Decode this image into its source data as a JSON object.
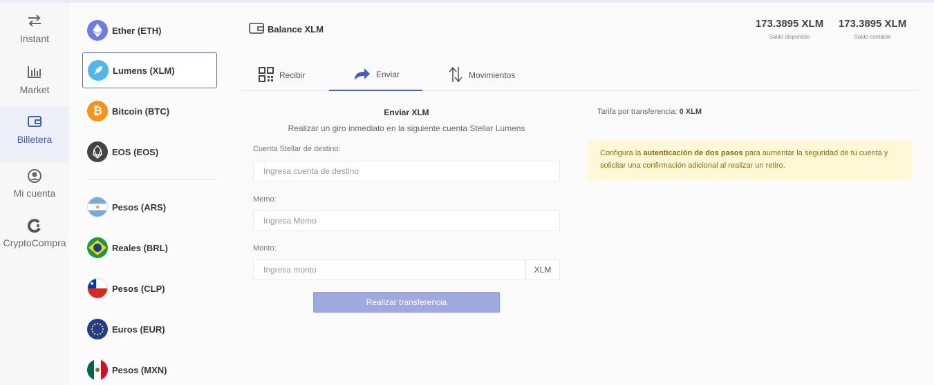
{
  "nav": {
    "items": [
      {
        "label": "Instant",
        "icon": "swap-arrows-icon"
      },
      {
        "label": "Market",
        "icon": "bar-chart-icon"
      },
      {
        "label": "Billetera",
        "icon": "wallet-icon"
      },
      {
        "label": "Mi cuenta",
        "icon": "user-circle-icon"
      },
      {
        "label": "CryptoCompra",
        "icon": "cryptocompra-icon"
      }
    ],
    "active": "Billetera"
  },
  "currencies": [
    {
      "label": "Ether (ETH)",
      "icon": "ethereum-icon",
      "color": "#6c7ce0"
    },
    {
      "label": "Lumens (XLM)",
      "icon": "rocket-icon",
      "color": "#4fb8ea",
      "selected": true
    },
    {
      "label": "Bitcoin (BTC)",
      "icon": "bitcoin-icon",
      "color": "#f7931a"
    },
    {
      "label": "EOS (EOS)",
      "icon": "eos-icon",
      "color": "#444444"
    },
    {
      "label": "Pesos (ARS)",
      "icon": "flag-argentina-icon"
    },
    {
      "label": "Reales (BRL)",
      "icon": "flag-brazil-icon"
    },
    {
      "label": "Pesos (CLP)",
      "icon": "flag-chile-icon"
    },
    {
      "label": "Euros (EUR)",
      "icon": "flag-eu-icon"
    },
    {
      "label": "Pesos (MXN)",
      "icon": "flag-mexico-icon"
    }
  ],
  "header": {
    "title": "Balance XLM",
    "available": {
      "value": "173.3895 XLM",
      "label": "Saldo disponible"
    },
    "accounting": {
      "value": "173.3895 XLM",
      "label": "Saldo contable"
    }
  },
  "tabs": [
    {
      "label": "Recibir",
      "icon": "qr-code-icon"
    },
    {
      "label": "Enviar",
      "icon": "send-arrow-icon",
      "active": true
    },
    {
      "label": "Movimientos",
      "icon": "up-down-arrows-icon"
    }
  ],
  "form": {
    "title": "Enviar XLM",
    "subtitle": "Realizar un giro inmediato en la siguiente cuenta Stellar Lumens",
    "dest_label": "Cuenta Stellar de destino:",
    "dest_placeholder": "Ingresa cuenta de destino",
    "memo_label": "Memo:",
    "memo_placeholder": "Ingresa Memo",
    "amount_label": "Monto:",
    "amount_placeholder": "Ingresa monto",
    "amount_unit": "XLM",
    "submit_label": "Realizar transferencia"
  },
  "fee": {
    "label": "Tarifa por transferencia:",
    "value": "0 XLM"
  },
  "alert": {
    "pre": "Configura la ",
    "bold": "autenticación de dos pasos",
    "post": " para aumentar la seguridad de tu cuenta y solicitar una confirmación adicional al realizar un retiro."
  },
  "colors": {
    "accent": "#3f5cc8",
    "button": "#9fa8df",
    "alert_bg": "#fdf9d7"
  }
}
